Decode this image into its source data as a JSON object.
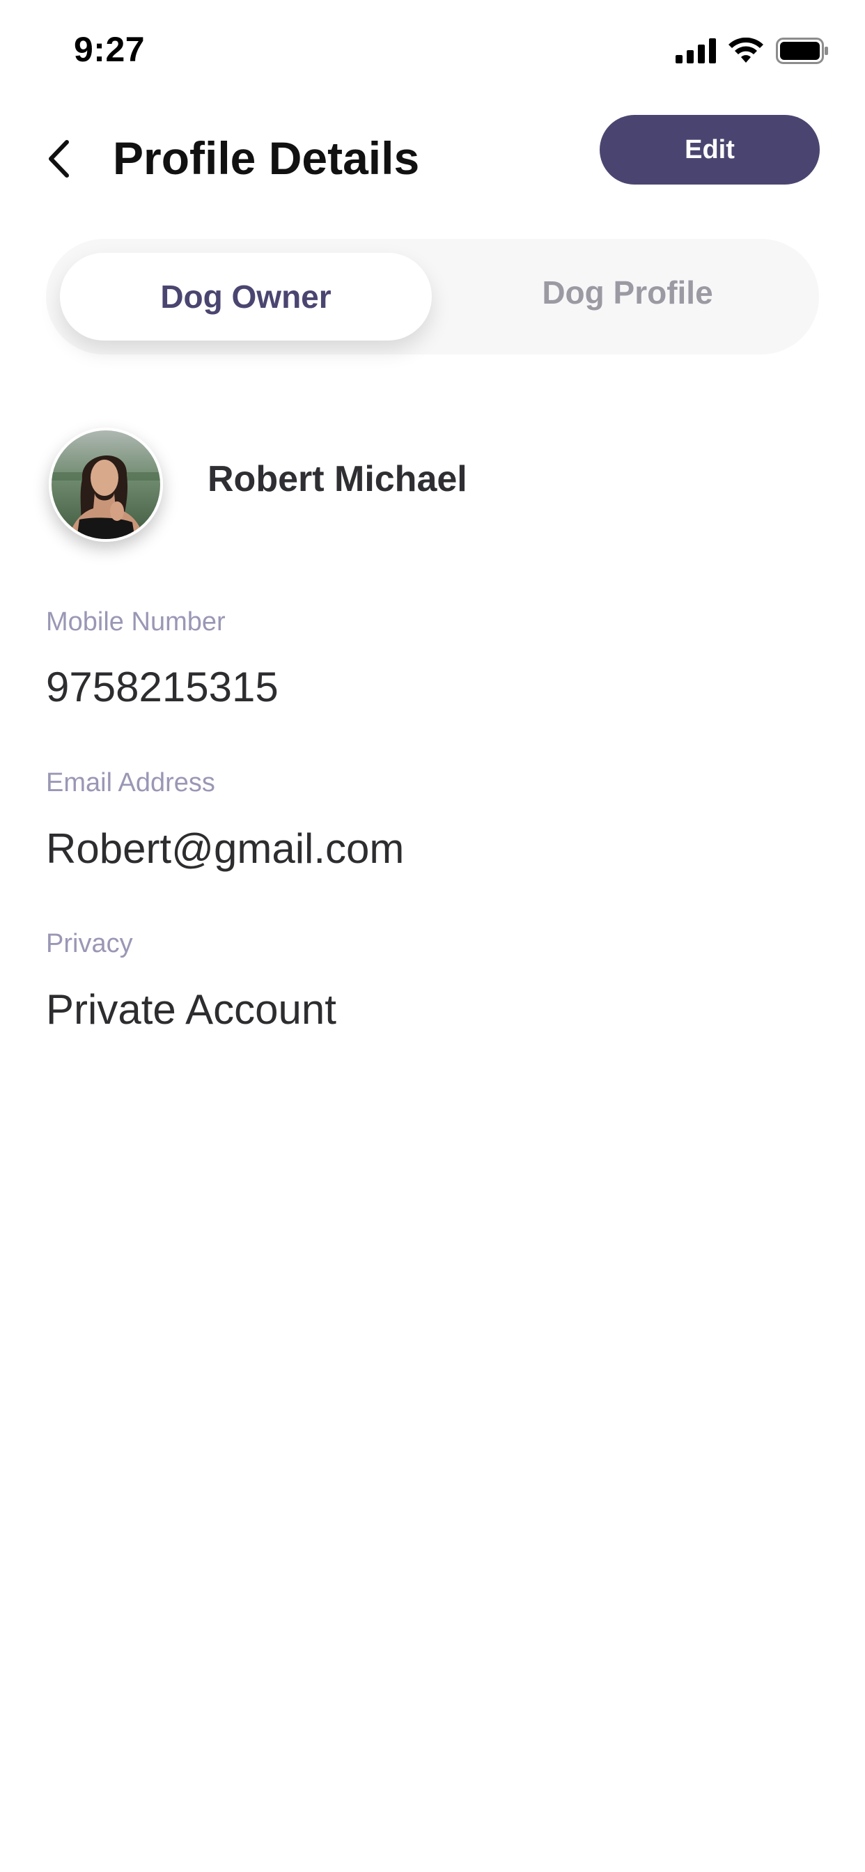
{
  "status_bar": {
    "time": "9:27",
    "icons": [
      "signal-icon",
      "wifi-icon",
      "battery-icon"
    ]
  },
  "header": {
    "title": "Profile Details",
    "edit_label": "Edit",
    "back_icon": "chevron-left-icon"
  },
  "tabs": [
    {
      "label": "Dog Owner",
      "active": true
    },
    {
      "label": "Dog Profile",
      "active": false
    }
  ],
  "profile": {
    "name": "Robert Michael"
  },
  "fields": [
    {
      "label": "Mobile Number",
      "value": "9758215315"
    },
    {
      "label": "Email Address",
      "value": "Robert@gmail.com"
    },
    {
      "label": "Privacy",
      "value": "Private Account"
    }
  ],
  "colors": {
    "accent": "#4a4570",
    "label": "#9a97b5",
    "inactive_tab": "#9b9aa3",
    "tab_track": "#f7f7f8"
  }
}
